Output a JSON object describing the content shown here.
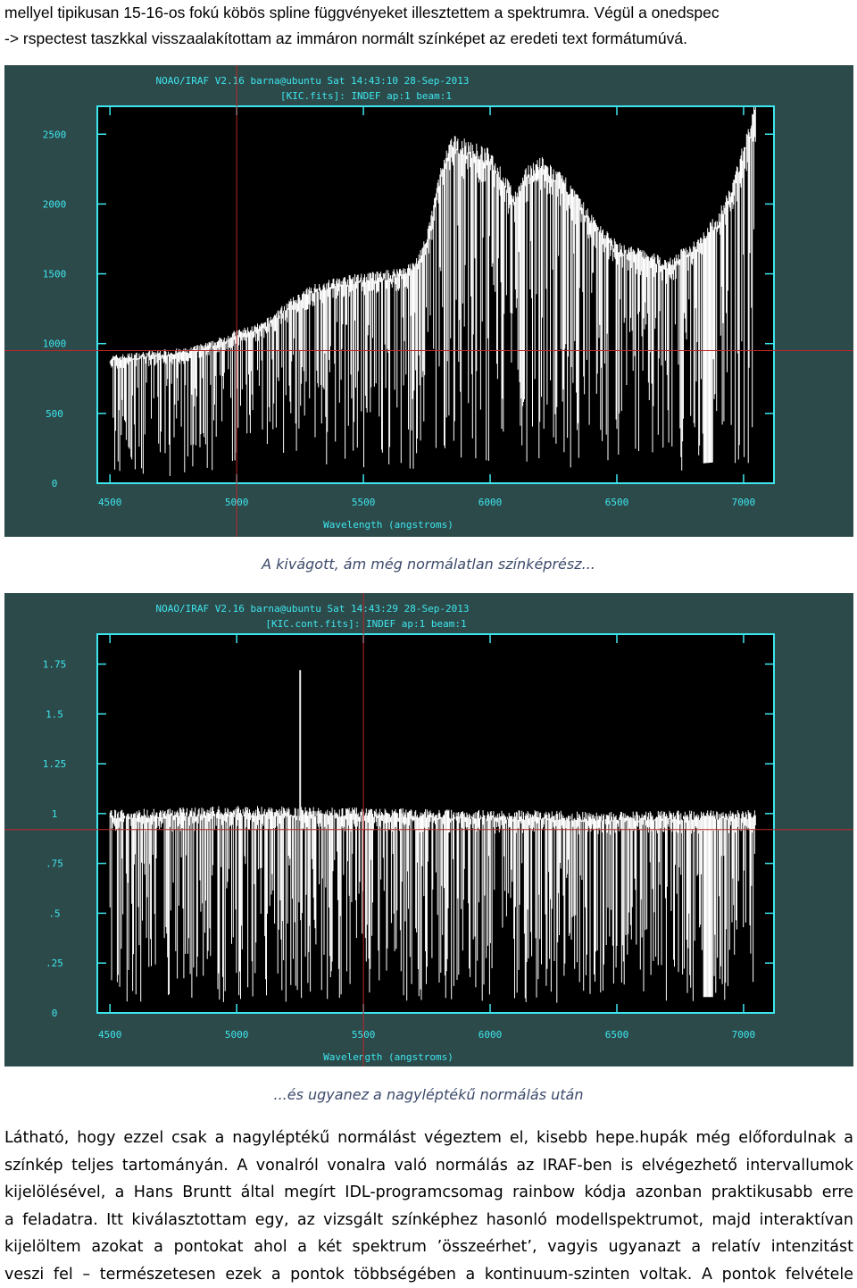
{
  "intro": {
    "line1": "mellyel tipikusan 15-16-os fokú köbös spline függvényeket illesztettem a spektrumra. Végül a onedspec",
    "line2": "-> rspectest taszkkal visszaalakítottam az immáron normált színképet az eredeti text formátumúvá."
  },
  "figure1": {
    "header1": "NOAO/IRAF V2.16 barna@ubuntu Sat 14:43:10 28-Sep-2013",
    "header2": "[KIC.fits]:  INDEF ap:1 beam:1",
    "xlabel": "Wavelength (angstroms)",
    "caption": "A kivágott, ám még normálatlan színképrész..."
  },
  "figure2": {
    "header1": "NOAO/IRAF V2.16 barna@ubuntu Sat 14:43:29 28-Sep-2013",
    "header2": "[KIC.cont.fits]:  INDEF ap:1 beam:1",
    "xlabel": "Wavelength (angstroms)",
    "caption": "...és ugyanez a nagyléptékű normálás után"
  },
  "chart_data": [
    {
      "type": "line",
      "title": "NOAO/IRAF V2.16 barna@ubuntu Sat 14:43:10 28-Sep-2013",
      "subtitle": "[KIC.fits]:  INDEF ap:1 beam:1",
      "xlabel": "Wavelength (angstroms)",
      "ylabel": "",
      "xlim": [
        4450,
        7120
      ],
      "ylim": [
        0,
        2700
      ],
      "xticks": [
        "4500",
        "5000",
        "5500",
        "6000",
        "6500",
        "7000"
      ],
      "yticks": [
        "0",
        "500",
        "1000",
        "1500",
        "2000",
        "2500"
      ],
      "cursor": [
        5000,
        950
      ],
      "series": [
        {
          "x": [
            4500,
            4600,
            4700,
            4800,
            4900,
            5000,
            5100,
            5200,
            5300,
            5400,
            5500,
            5600,
            5700,
            5750,
            5800,
            5850,
            5900,
            6000,
            6100,
            6150,
            6200,
            6300,
            6400,
            6500,
            6600,
            6700,
            6800,
            6900,
            6950,
            7000,
            7050
          ],
          "y": [
            900,
            920,
            940,
            950,
            1000,
            1080,
            1130,
            1280,
            1400,
            1450,
            1480,
            1500,
            1560,
            1750,
            2200,
            2450,
            2420,
            2350,
            2050,
            2250,
            2300,
            2150,
            1900,
            1700,
            1650,
            1580,
            1700,
            1900,
            2100,
            2400,
            2700
          ]
        }
      ]
    },
    {
      "type": "line",
      "title": "NOAO/IRAF V2.16 barna@ubuntu Sat 14:43:29 28-Sep-2013",
      "subtitle": "[KIC.cont.fits]:  INDEF ap:1 beam:1",
      "xlabel": "Wavelength (angstroms)",
      "ylabel": "",
      "xlim": [
        4450,
        7120
      ],
      "ylim": [
        0,
        1.9
      ],
      "xticks": [
        "4500",
        "5000",
        "5500",
        "6000",
        "6500",
        "7000"
      ],
      "yticks": [
        "0",
        ".25",
        ".5",
        ".75",
        "1",
        "1.25",
        "1.5",
        "1.75"
      ],
      "cursor": [
        5500,
        0.92
      ],
      "series": [
        {
          "x": [
            4500,
            5000,
            5500,
            6000,
            6500,
            7000,
            7050
          ],
          "y": [
            1.0,
            1.02,
            1.01,
            1.0,
            0.99,
            1.0,
            1.0
          ]
        }
      ]
    }
  ],
  "body": {
    "line1": "Látható, hogy ezzel csak a nagyléptékű normálást végeztem el, kisebb hepe.hupák még előfordulnak a",
    "line2": "színkép teljes tartományán. A vonalról vonalra való normálás az IRAF-ben is elvégezhető intervallumok",
    "line3": "kijelölésével, a Hans Bruntt által megírt IDL-programcsomag rainbow kódja azonban praktikusabb erre",
    "line4": "a feladatra. Itt kiválasztottam egy, az vizsgált színképhez hasonló modellspektrumot, majd interaktívan",
    "line5": "kijelöltem azokat a pontokat ahol a két spektrum ’összeérhet’, vagyis ugyanazt a relatív intenzitást",
    "line6": "veszi fel – természetesen ezek a pontok többségében a kontinuum-szinten voltak. A pontok felvétele"
  }
}
